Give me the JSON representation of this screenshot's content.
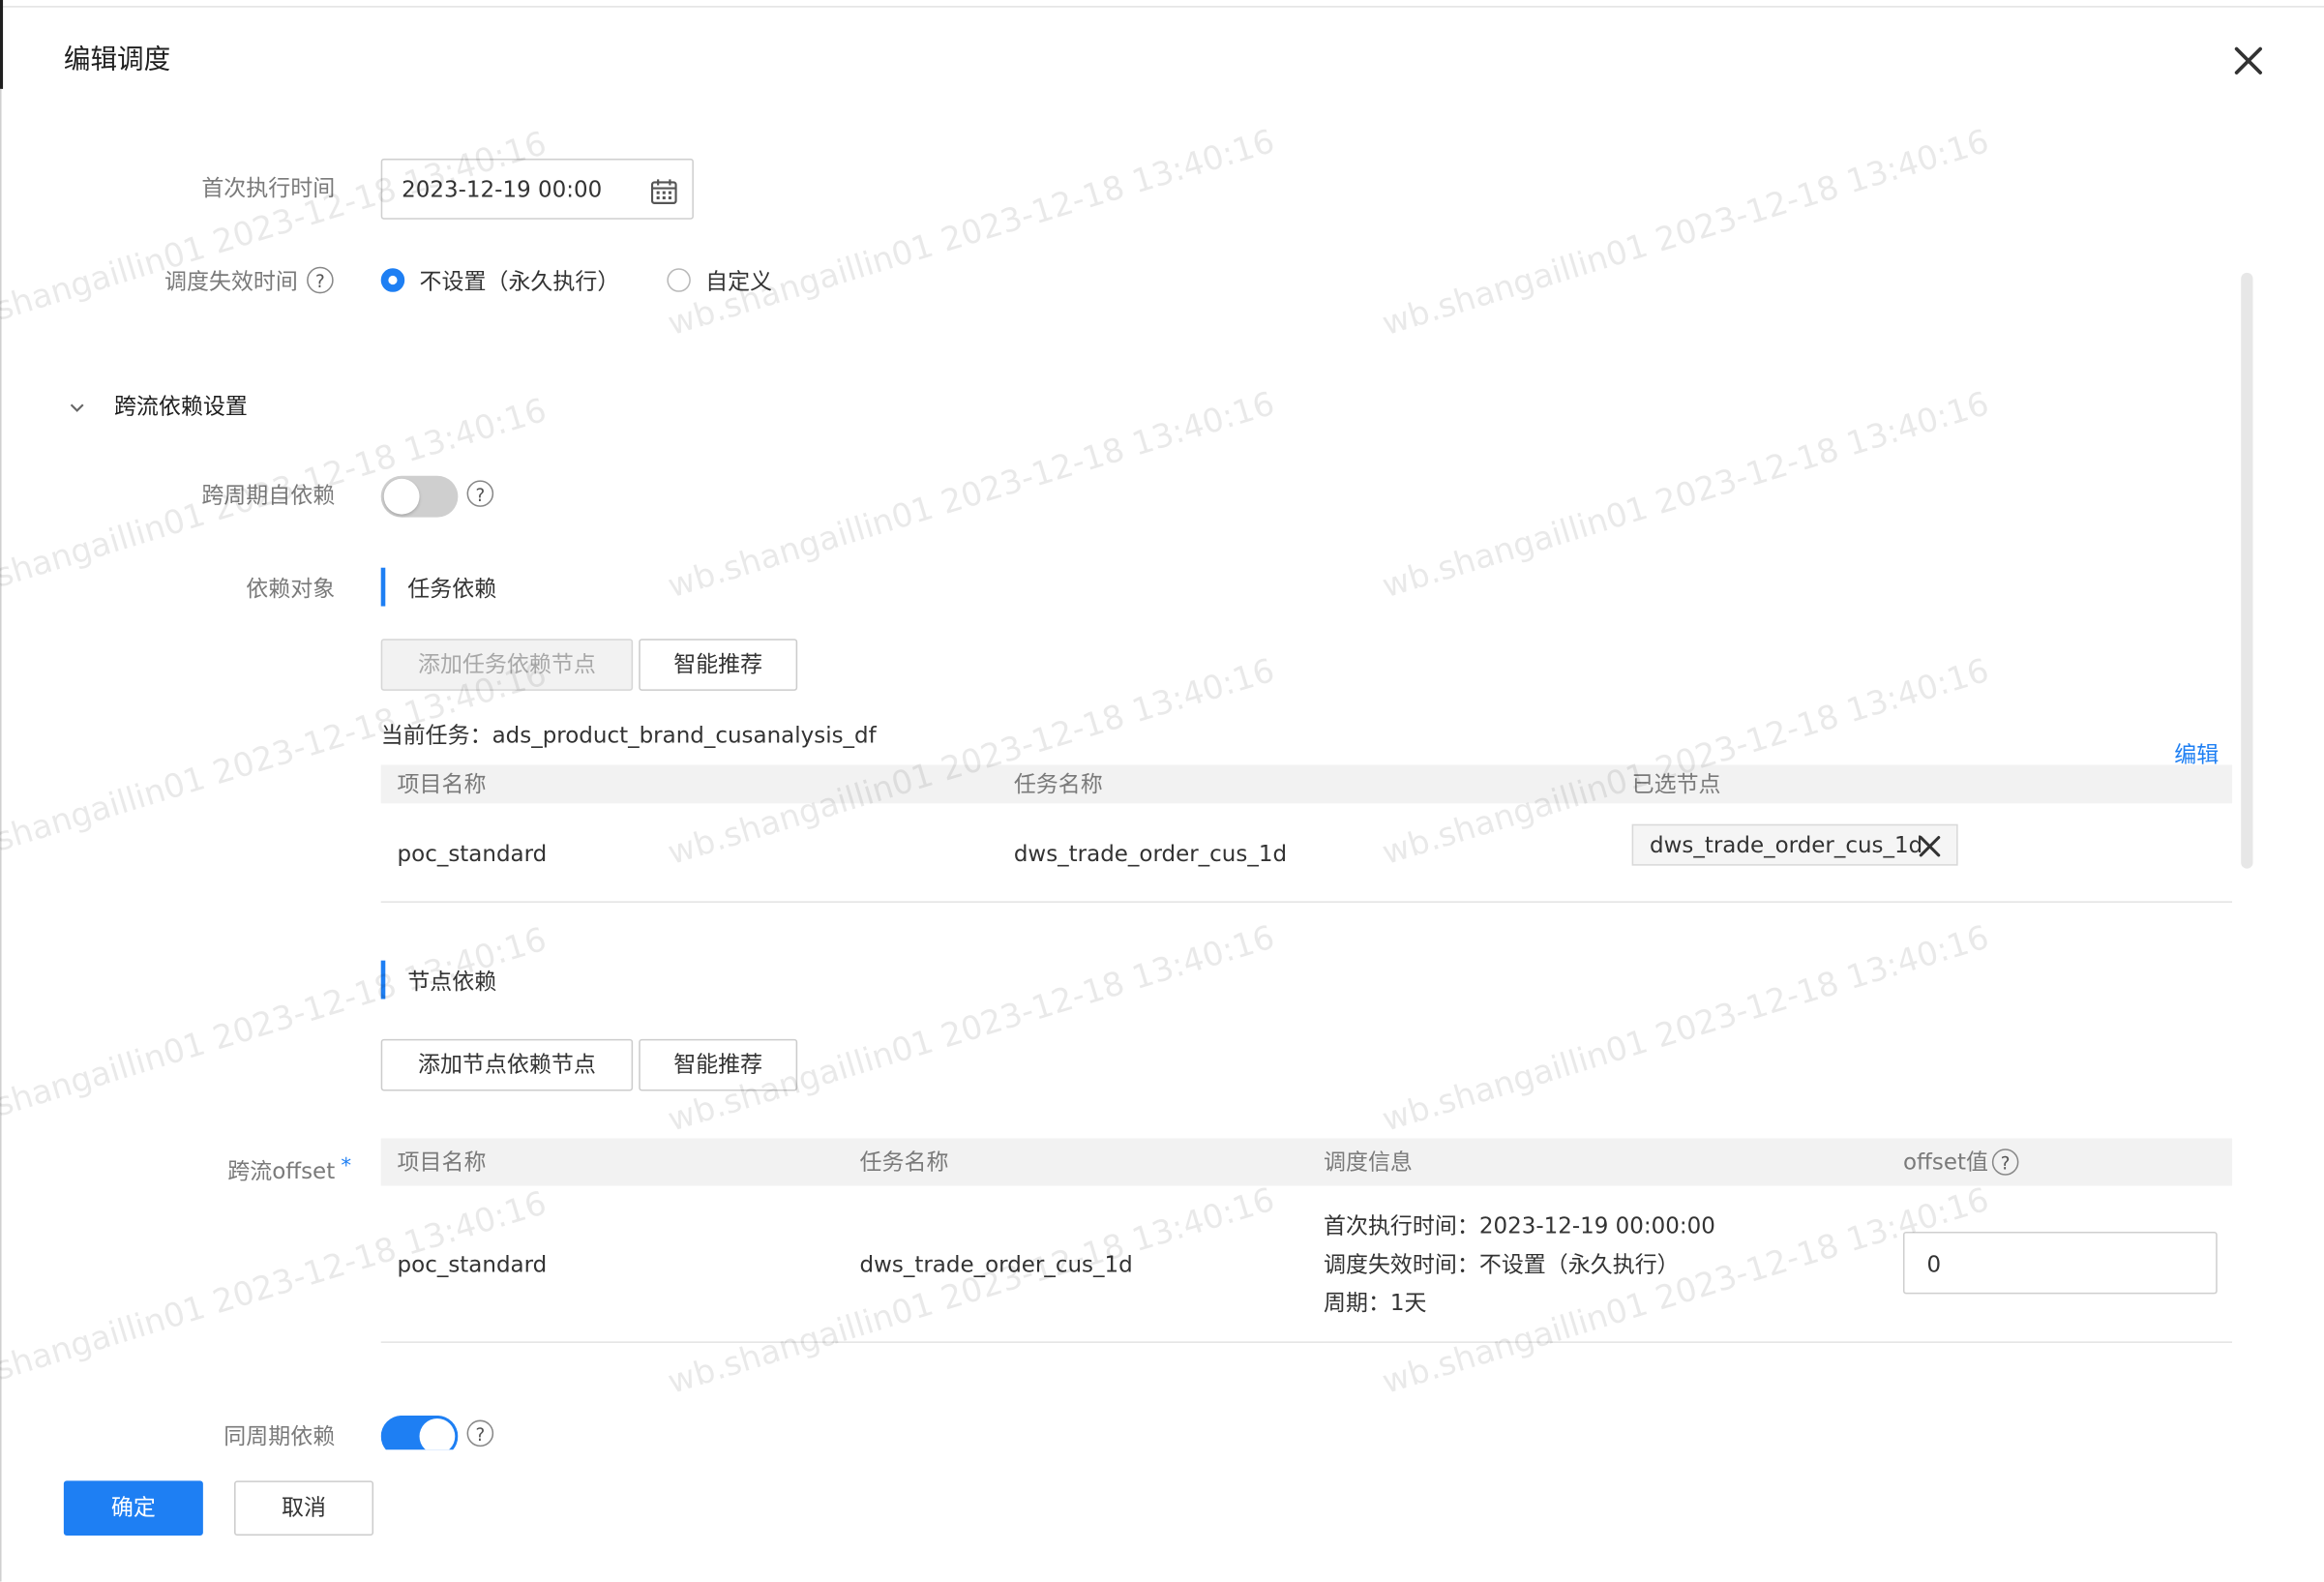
{
  "dialog": {
    "title": "编辑调度"
  },
  "first_exec": {
    "label": "首次执行时间",
    "value": "2023-12-19 00:00"
  },
  "expire": {
    "label": "调度失效时间",
    "options": [
      {
        "label": "不设置（永久执行）",
        "selected": true
      },
      {
        "label": "自定义",
        "selected": false
      }
    ]
  },
  "cross_flow": {
    "title": "跨流依赖设置"
  },
  "cross_cycle": {
    "label": "跨周期自依赖",
    "enabled": false
  },
  "dep_target": {
    "label": "依赖对象"
  },
  "task_dep": {
    "title": "任务依赖",
    "add_button": "添加任务依赖节点",
    "smart_button": "智能推荐",
    "current_task_label": "当前任务：ads_product_brand_cusanalysis_df",
    "edit_link": "编辑",
    "headers": [
      "项目名称",
      "任务名称",
      "已选节点"
    ],
    "rows": [
      {
        "project": "poc_standard",
        "task": "dws_trade_order_cus_1d",
        "node_tag": "dws_trade_order_cus_1d"
      }
    ]
  },
  "node_dep": {
    "title": "节点依赖",
    "add_button": "添加节点依赖节点",
    "smart_button": "智能推荐"
  },
  "offset": {
    "label": "跨流offset",
    "required_mark": "*",
    "headers": [
      "项目名称",
      "任务名称",
      "调度信息",
      "offset值"
    ],
    "rows": [
      {
        "project": "poc_standard",
        "task": "dws_trade_order_cus_1d",
        "info_first": "首次执行时间：2023-12-19 00:00:00",
        "info_expire": "调度失效时间：不设置（永久执行）",
        "info_cycle": "周期：1天",
        "offset_value": "0"
      }
    ]
  },
  "same_cycle": {
    "label": "同周期依赖",
    "enabled": true
  },
  "footer": {
    "ok": "确定",
    "cancel": "取消"
  },
  "watermarks": [
    "shangaillin01 2023-12-18 13:40:16",
    "wb.shangaillin01 2023-12-18 13:40:16",
    "wb.shangaillin01 2023-12-18 13:40:16",
    "shangaillin01 2023-12-18 13:40:16",
    "wb.shangaillin01 2023-12-18 13:40:16",
    "wb.shangaillin01 2023-12-18 13:40:16",
    "shangaillin01 2023-12-18 13:40:16",
    "wb.shangaillin01 2023-12-18 13:40:16",
    "wb.shangaillin01 2023-12-18 13:40:16",
    "shangaillin01 2023-12-18 13:40:16",
    "wb.shangaillin01 2023-12-18 13:40:16",
    "wb.shangaillin01 2023-12-18 13:40:16",
    "shangaillin01 2023-12-18 13:40:16",
    "wb.shangaillin01 2023-12-18 13:40:16",
    "wb.shangaillin01 2023-12-18 13:40:16"
  ],
  "colors": {
    "primary": "#1e7ff3",
    "header_bg": "#f2f2f2",
    "label": "#7a7a7a"
  },
  "icons": {
    "close": "close-icon",
    "calendar": "calendar-icon",
    "collapse": "chevron-down-icon",
    "help": "question-circle-icon",
    "tag_remove": "x-icon"
  }
}
